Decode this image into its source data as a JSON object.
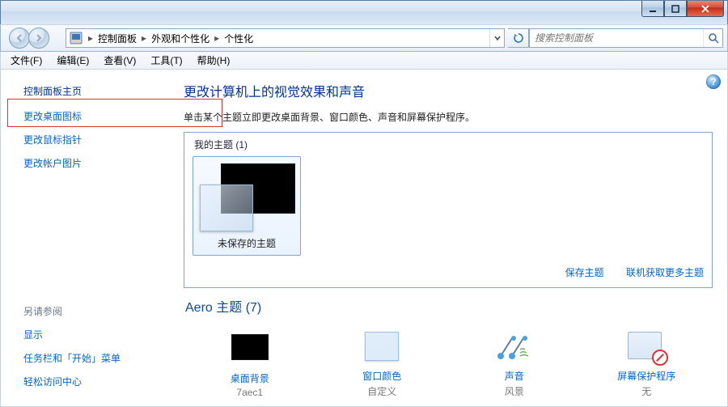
{
  "breadcrumb": {
    "root_icon": "control-panel-icon",
    "root": "控制面板",
    "level1": "外观和个性化",
    "level2": "个性化"
  },
  "search": {
    "placeholder": "搜索控制面板"
  },
  "menu": {
    "file": "文件(F)",
    "edit": "编辑(E)",
    "view": "查看(V)",
    "tools": "工具(T)",
    "help": "帮助(H)"
  },
  "sidebar": {
    "home": "控制面板主页",
    "links": {
      "desktop_icons": "更改桌面图标",
      "mouse_pointers": "更改鼠标指针",
      "account_picture": "更改帐户图片"
    },
    "see_also_header": "另请参阅",
    "see_also": {
      "display": "显示",
      "taskbar": "任务栏和「开始」菜单",
      "ease": "轻松访问中心"
    }
  },
  "content": {
    "title": "更改计算机上的视觉效果和声音",
    "subtitle": "单击某个主题立即更改桌面背景、窗口颜色、声音和屏幕保护程序。",
    "my_themes_header": "我的主题 (1)",
    "theme_unsaved": "未保存的主题",
    "save_theme": "保存主题",
    "get_more": "联机获取更多主题",
    "aero_header": "Aero 主题 (7)"
  },
  "footer": {
    "bg": {
      "label": "桌面背景",
      "value": "7aec1"
    },
    "wincolor": {
      "label": "窗口颜色",
      "value": "自定义"
    },
    "sound": {
      "label": "声音",
      "value": "风景"
    },
    "screensaver": {
      "label": "屏幕保护程序",
      "value": "无"
    }
  }
}
